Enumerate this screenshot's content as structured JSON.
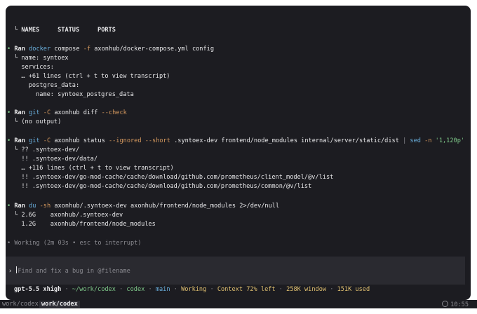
{
  "table_header": {
    "prefix": "└ ",
    "cols": [
      "NAMES",
      "STATUS",
      "PORTS"
    ]
  },
  "block1": {
    "bullet": "•",
    "ran": "Ran",
    "cmd": "docker",
    "rest1": " compose ",
    "flag": "-f",
    "rest2": " axonhub/docker-compose.yml config",
    "lines": [
      "└ name: syntoex",
      "  services:",
      "  … +61 lines (ctrl + t to view transcript)",
      "    postgres_data:",
      "      name: syntoex_postgres_data"
    ]
  },
  "block2": {
    "bullet": "•",
    "ran": "Ran",
    "cmd": "git",
    "flag1": " -C",
    "rest": " axonhub diff ",
    "flag2": "--check",
    "lines": [
      "└ (no output)"
    ]
  },
  "block3": {
    "bullet": "•",
    "ran": "Ran",
    "cmd": "git",
    "flag1": " -C",
    "rest1": " axonhub status ",
    "flag2": "--ignored --short",
    "rest2": " .syntoex-dev frontend/node_modules internal/server/static/dist ",
    "pipe": "|",
    "cmd2": " sed",
    "flag3": " -n",
    "str": " '1,120p'",
    "lines": [
      "└ ?? .syntoex-dev/",
      "  !! .syntoex-dev/data/",
      "  … +116 lines (ctrl + t to view transcript)",
      "  !! .syntoex-dev/go-mod-cache/cache/download/github.com/prometheus/client_model/@v/list",
      "  !! .syntoex-dev/go-mod-cache/cache/download/github.com/prometheus/common/@v/list"
    ]
  },
  "block4": {
    "bullet": "•",
    "ran": "Ran",
    "cmd": "du",
    "flag": " -sh",
    "rest": " axonhub/.syntoex-dev axonhub/frontend/node_modules 2>/dev/null",
    "lines": [
      "└ 2.6G    axonhub/.syntoex-dev",
      "  1.2G    axonhub/frontend/node_modules"
    ]
  },
  "working": {
    "bullet": "•",
    "label": "Working",
    "detail": " (2m 03s • esc to interrupt)"
  },
  "input": {
    "prompt": "›",
    "text": "Find and fix a bug in @filename"
  },
  "status": {
    "model": "gpt-5.5 xhigh",
    "path": "~/work/codex",
    "project": "codex",
    "branch": "main",
    "state": "Working",
    "context": "Context 72% left",
    "window": "258K window",
    "used": "151K used",
    "sep": " · "
  },
  "tabs": {
    "tab1": "work/codex",
    "tab2": "work/codex",
    "clock": "10:55"
  }
}
